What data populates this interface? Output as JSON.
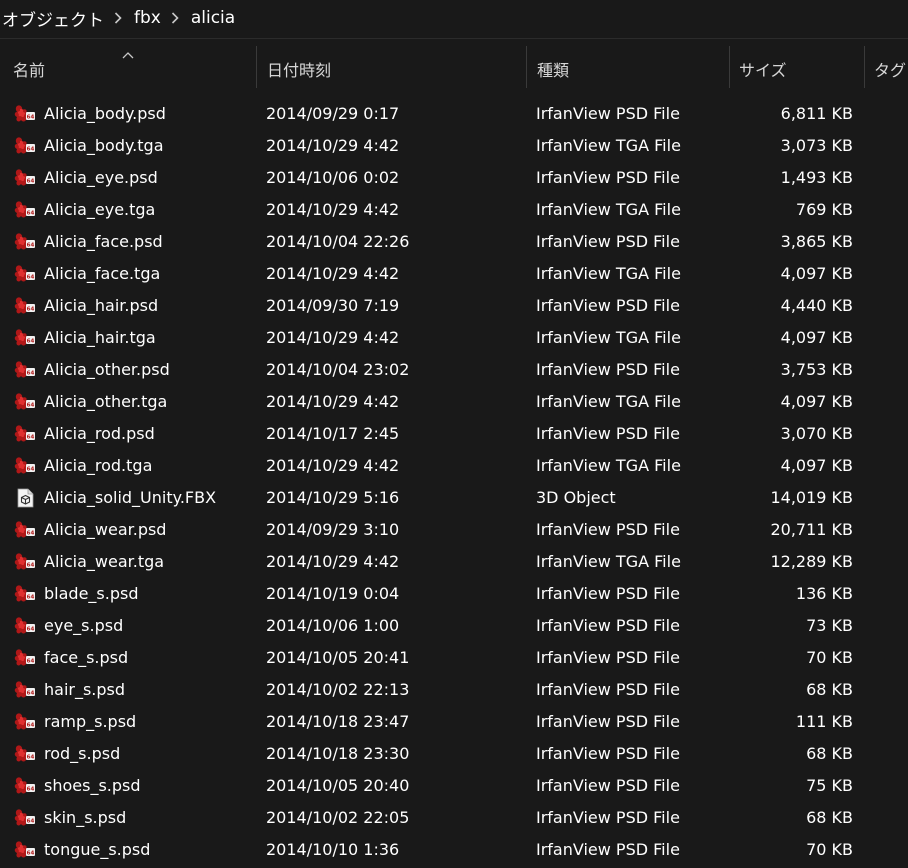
{
  "breadcrumb": [
    "オブジェクト",
    "fbx",
    "alicia"
  ],
  "columns": {
    "name": "名前",
    "date": "日付時刻",
    "type": "種類",
    "size": "サイズ",
    "tags": "タグ"
  },
  "colors": {
    "background": "#191919",
    "text": "#ffffff",
    "header_text": "#d6d6d6",
    "divider": "#3a3a3a",
    "irfanview_icon": "#b01818"
  },
  "files": [
    {
      "name": "Alicia_body.psd",
      "date": "2014/09/29 0:17",
      "type": "IrfanView PSD File",
      "size": "6,811 KB",
      "icon": "irfanview-icon"
    },
    {
      "name": "Alicia_body.tga",
      "date": "2014/10/29 4:42",
      "type": "IrfanView TGA File",
      "size": "3,073 KB",
      "icon": "irfanview-icon"
    },
    {
      "name": "Alicia_eye.psd",
      "date": "2014/10/06 0:02",
      "type": "IrfanView PSD File",
      "size": "1,493 KB",
      "icon": "irfanview-icon"
    },
    {
      "name": "Alicia_eye.tga",
      "date": "2014/10/29 4:42",
      "type": "IrfanView TGA File",
      "size": "769 KB",
      "icon": "irfanview-icon"
    },
    {
      "name": "Alicia_face.psd",
      "date": "2014/10/04 22:26",
      "type": "IrfanView PSD File",
      "size": "3,865 KB",
      "icon": "irfanview-icon"
    },
    {
      "name": "Alicia_face.tga",
      "date": "2014/10/29 4:42",
      "type": "IrfanView TGA File",
      "size": "4,097 KB",
      "icon": "irfanview-icon"
    },
    {
      "name": "Alicia_hair.psd",
      "date": "2014/09/30 7:19",
      "type": "IrfanView PSD File",
      "size": "4,440 KB",
      "icon": "irfanview-icon"
    },
    {
      "name": "Alicia_hair.tga",
      "date": "2014/10/29 4:42",
      "type": "IrfanView TGA File",
      "size": "4,097 KB",
      "icon": "irfanview-icon"
    },
    {
      "name": "Alicia_other.psd",
      "date": "2014/10/04 23:02",
      "type": "IrfanView PSD File",
      "size": "3,753 KB",
      "icon": "irfanview-icon"
    },
    {
      "name": "Alicia_other.tga",
      "date": "2014/10/29 4:42",
      "type": "IrfanView TGA File",
      "size": "4,097 KB",
      "icon": "irfanview-icon"
    },
    {
      "name": "Alicia_rod.psd",
      "date": "2014/10/17 2:45",
      "type": "IrfanView PSD File",
      "size": "3,070 KB",
      "icon": "irfanview-icon"
    },
    {
      "name": "Alicia_rod.tga",
      "date": "2014/10/29 4:42",
      "type": "IrfanView TGA File",
      "size": "4,097 KB",
      "icon": "irfanview-icon"
    },
    {
      "name": "Alicia_solid_Unity.FBX",
      "date": "2014/10/29 5:16",
      "type": "3D Object",
      "size": "14,019 KB",
      "icon": "3d-object-icon"
    },
    {
      "name": "Alicia_wear.psd",
      "date": "2014/09/29 3:10",
      "type": "IrfanView PSD File",
      "size": "20,711 KB",
      "icon": "irfanview-icon"
    },
    {
      "name": "Alicia_wear.tga",
      "date": "2014/10/29 4:42",
      "type": "IrfanView TGA File",
      "size": "12,289 KB",
      "icon": "irfanview-icon"
    },
    {
      "name": "blade_s.psd",
      "date": "2014/10/19 0:04",
      "type": "IrfanView PSD File",
      "size": "136 KB",
      "icon": "irfanview-icon"
    },
    {
      "name": "eye_s.psd",
      "date": "2014/10/06 1:00",
      "type": "IrfanView PSD File",
      "size": "73 KB",
      "icon": "irfanview-icon"
    },
    {
      "name": "face_s.psd",
      "date": "2014/10/05 20:41",
      "type": "IrfanView PSD File",
      "size": "70 KB",
      "icon": "irfanview-icon"
    },
    {
      "name": "hair_s.psd",
      "date": "2014/10/02 22:13",
      "type": "IrfanView PSD File",
      "size": "68 KB",
      "icon": "irfanview-icon"
    },
    {
      "name": "ramp_s.psd",
      "date": "2014/10/18 23:47",
      "type": "IrfanView PSD File",
      "size": "111 KB",
      "icon": "irfanview-icon"
    },
    {
      "name": "rod_s.psd",
      "date": "2014/10/18 23:30",
      "type": "IrfanView PSD File",
      "size": "68 KB",
      "icon": "irfanview-icon"
    },
    {
      "name": "shoes_s.psd",
      "date": "2014/10/05 20:40",
      "type": "IrfanView PSD File",
      "size": "75 KB",
      "icon": "irfanview-icon"
    },
    {
      "name": "skin_s.psd",
      "date": "2014/10/02 22:05",
      "type": "IrfanView PSD File",
      "size": "68 KB",
      "icon": "irfanview-icon"
    },
    {
      "name": "tongue_s.psd",
      "date": "2014/10/10 1:36",
      "type": "IrfanView PSD File",
      "size": "70 KB",
      "icon": "irfanview-icon"
    }
  ]
}
